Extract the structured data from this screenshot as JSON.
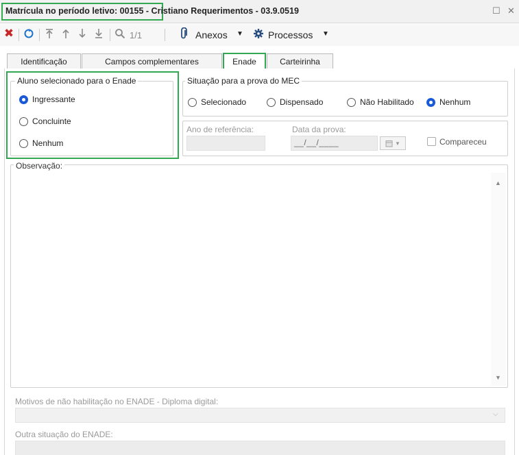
{
  "window": {
    "title_highlight": "Matrícula no período letivo: 00155",
    "title_rest": " - Cristiano Requerimentos - 03.9.0519",
    "restore_glyph": "☐",
    "close_glyph": "✕"
  },
  "toolbar": {
    "pager": "1/1",
    "anexos_label": "Anexos",
    "processos_label": "Processos",
    "icons": [
      "delete-icon",
      "refresh-icon",
      "first-icon",
      "prev-icon",
      "next-icon",
      "last-icon",
      "search-icon",
      "paperclip-icon",
      "gear-icon"
    ]
  },
  "tabs": [
    {
      "label": "Identificação"
    },
    {
      "label": "Campos complementares"
    },
    {
      "label": "Enade"
    },
    {
      "label": "Carteirinha"
    }
  ],
  "enade": {
    "aluno_group": {
      "legend": "Aluno selecionado para o Enade",
      "options": [
        "Ingressante",
        "Concluinte",
        "Nenhum"
      ],
      "selected": "Ingressante"
    },
    "situacao_group": {
      "legend": "Situação para a prova do MEC",
      "options": [
        "Selecionado",
        "Dispensado",
        "Não Habilitado",
        "Nenhum"
      ],
      "selected": "Nenhum"
    },
    "ano_referencia_label": "Ano de referência:",
    "data_prova_label": "Data da prova:",
    "data_prova_value": "__/__/____",
    "compareceu_label": "Compareceu",
    "observacao_label": "Observação:",
    "motivos_label": "Motivos de não habilitação no ENADE - Diploma digital:",
    "outra_situacao_label": "Outra situação do ENADE:"
  },
  "colors": {
    "highlight": "#33a852",
    "radio_selected": "#1a5ad8",
    "delete_red": "#c62828",
    "refresh_blue": "#1e73c8"
  }
}
